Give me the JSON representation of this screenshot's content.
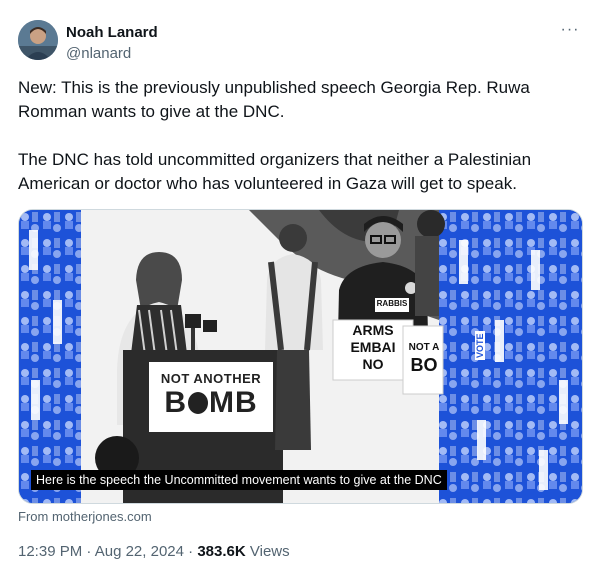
{
  "author": {
    "display_name": "Noah Lanard",
    "handle": "@nlanard"
  },
  "more_menu": {
    "icon": "more-horizontal-icon",
    "label": "···"
  },
  "tweet": {
    "paragraphs": [
      "New: This is the previously unpublished speech Georgia Rep. Ruwa Romman wants to give at the DNC.",
      "The DNC has told uncommitted organizers that neither a Palestinian American or doctor who has volunteered in Gaza will get to speak."
    ]
  },
  "media": {
    "caption": "Here is the speech the Uncommitted movement wants to give at the DNC",
    "podium_sign": {
      "line1": "NOT ANOTHER",
      "line2": "B",
      "line3": "MB"
    },
    "protest_sign": {
      "line1": "ARMS",
      "line2": "EMBAI",
      "line3": "NO"
    },
    "second_sign": {
      "line1": "NOT A",
      "line2": "BO"
    },
    "shirt_text": "RABBIS",
    "side_poster_text": "VOTE",
    "side_colors": {
      "blue": "#1d52d8",
      "light": "#cfdcff"
    }
  },
  "card_source": "From motherjones.com",
  "meta": {
    "time": "12:39 PM",
    "separator": "·",
    "date": "Aug 22, 2024",
    "views_count": "383.6K",
    "views_label": "Views"
  }
}
